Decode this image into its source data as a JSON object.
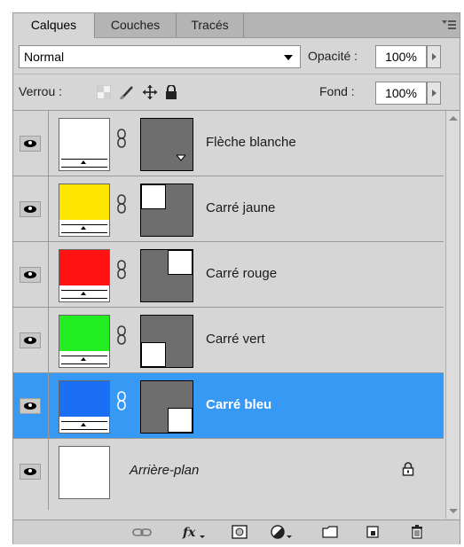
{
  "tabs": [
    {
      "label": "Calques",
      "active": true
    },
    {
      "label": "Couches",
      "active": false
    },
    {
      "label": "Tracés",
      "active": false
    }
  ],
  "blend_mode": "Normal",
  "opacity": {
    "label": "Opacité :",
    "value": "100%"
  },
  "lock": {
    "label": "Verrou :"
  },
  "fill": {
    "label": "Fond :",
    "value": "100%"
  },
  "layers": [
    {
      "name": "Flèche blanche",
      "color": "#ffffff"
    },
    {
      "name": "Carré jaune",
      "color": "#ffe600"
    },
    {
      "name": "Carré rouge",
      "color": "#ff1212"
    },
    {
      "name": "Carré vert",
      "color": "#22ee22"
    },
    {
      "name": "Carré bleu",
      "color": "#1a6ff4",
      "selected": true
    },
    {
      "name": "Arrière-plan",
      "color": "#ffffff",
      "background": true,
      "locked": true
    }
  ],
  "colors": {
    "selection": "#3899f4",
    "panel": "#d6d6d6"
  },
  "footer_icons": [
    "link-icon",
    "fx-icon",
    "mask-icon",
    "adjustment-icon",
    "folder-icon",
    "new-layer-icon",
    "trash-icon"
  ]
}
